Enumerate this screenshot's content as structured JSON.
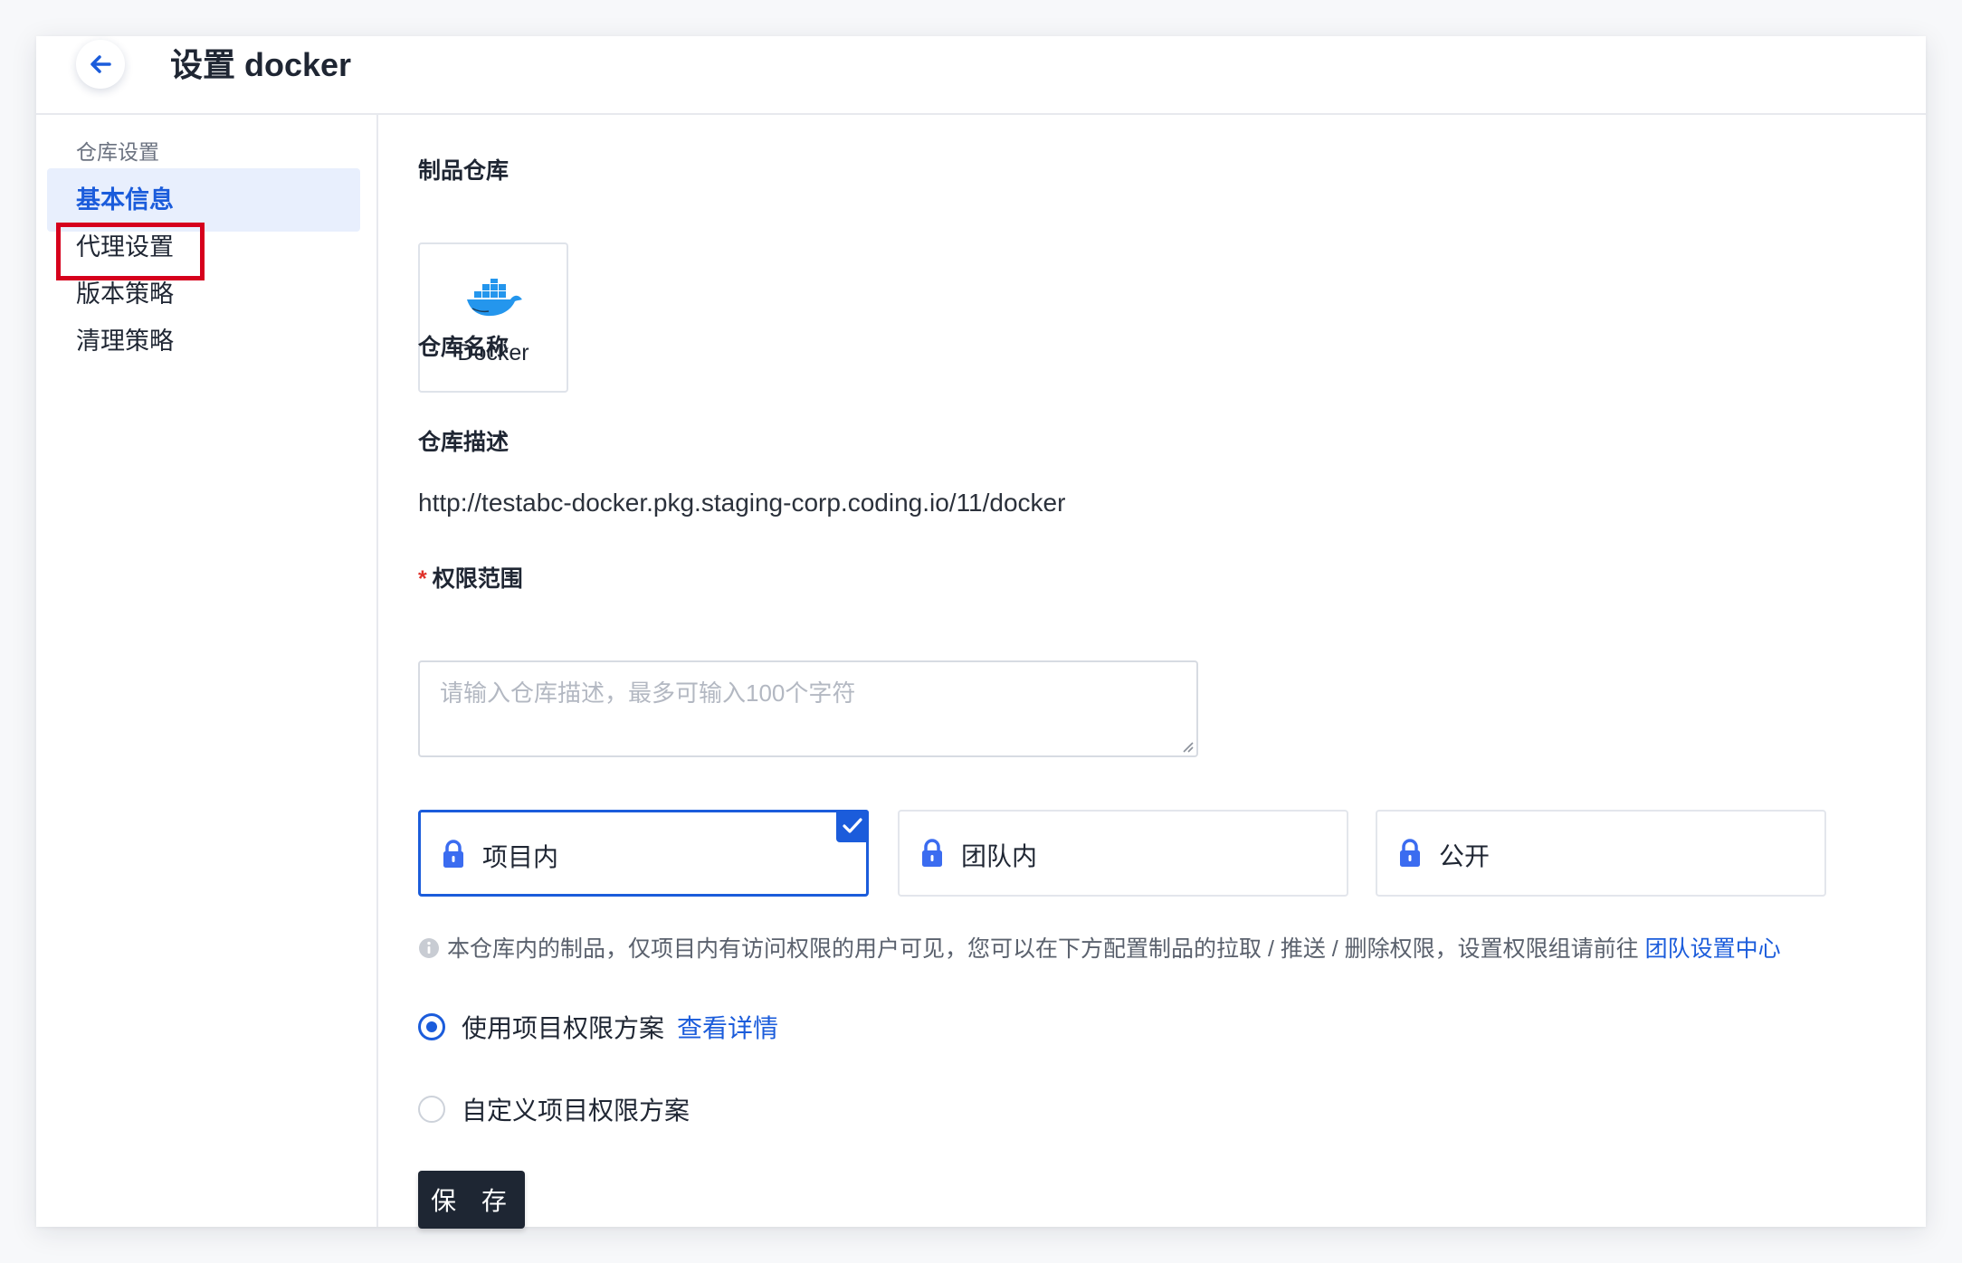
{
  "header": {
    "title": "设置 docker"
  },
  "sidebar": {
    "heading": "仓库设置",
    "items": [
      {
        "label": "基本信息",
        "active": true
      },
      {
        "label": "代理设置"
      },
      {
        "label": "版本策略"
      },
      {
        "label": "清理策略"
      }
    ]
  },
  "main": {
    "artifact_label": "制品仓库",
    "artifact_name": "Docker",
    "repo_name_label": "仓库名称",
    "repo_url": "http://testabc-docker.pkg.staging-corp.coding.io/11/docker",
    "desc_label": "仓库描述",
    "desc_placeholder": "请输入仓库描述，最多可输入100个字符",
    "perm_required": "*",
    "perm_label": "权限范围",
    "perm_options": [
      {
        "label": "项目内",
        "selected": true
      },
      {
        "label": "团队内"
      },
      {
        "label": "公开"
      }
    ],
    "info_text": "本仓库内的制品，仅项目内有访问权限的用户可见，您可以在下方配置制品的拉取 / 推送 / 删除权限，设置权限组请前往",
    "info_link": "团队设置中心",
    "radio_use_project": "使用项目权限方案",
    "radio_view_detail": "查看详情",
    "radio_custom": "自定义项目权限方案",
    "save_label": "保 存"
  },
  "colors": {
    "accent": "#1b5cdb",
    "highlight": "#d6001c",
    "dark_button": "#1e2633",
    "docker_blue": "#2496ed"
  }
}
